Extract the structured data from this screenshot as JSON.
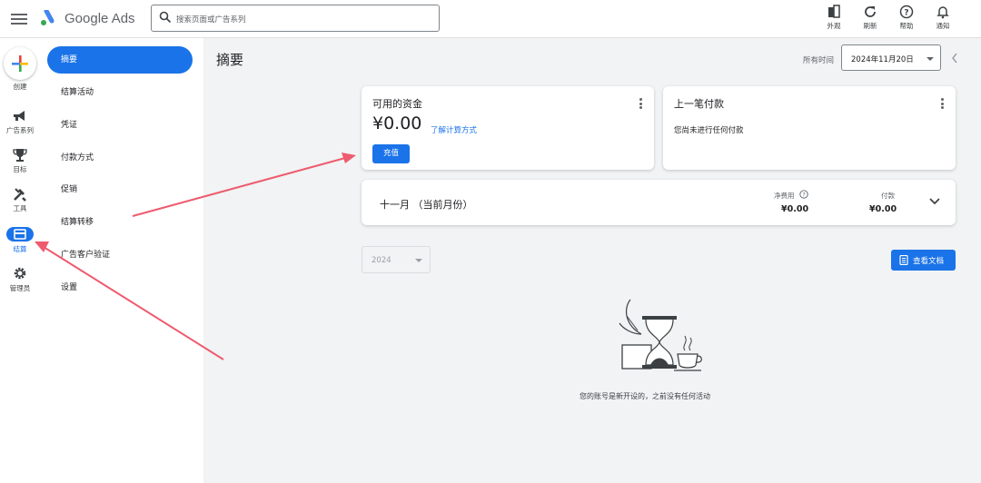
{
  "app": {
    "logo_text": "Google Ads"
  },
  "search": {
    "placeholder": "搜索页面或广告系列"
  },
  "top_actions": [
    {
      "label": "外观",
      "icon": "appearance-icon"
    },
    {
      "label": "刷新",
      "icon": "refresh-icon"
    },
    {
      "label": "帮助",
      "icon": "help-icon"
    },
    {
      "label": "通知",
      "icon": "bell-icon"
    }
  ],
  "rail": {
    "create": "创建",
    "items": [
      {
        "label": "广告系列",
        "icon": "megaphone-icon"
      },
      {
        "label": "目标",
        "icon": "trophy-icon"
      },
      {
        "label": "工具",
        "icon": "tools-icon"
      },
      {
        "label": "结算",
        "icon": "billing-icon"
      },
      {
        "label": "管理员",
        "icon": "gear-icon"
      }
    ]
  },
  "nav": {
    "items": [
      {
        "label": "摘要"
      },
      {
        "label": "结算活动"
      },
      {
        "label": "凭证"
      },
      {
        "label": "付款方式"
      },
      {
        "label": "促销"
      },
      {
        "label": "结算转移"
      },
      {
        "label": "广告客户验证"
      },
      {
        "label": "设置"
      }
    ]
  },
  "main": {
    "title": "摘要",
    "date_label": "所有时间",
    "date_value": "2024年11月20日"
  },
  "funds_card": {
    "title": "可用的资金",
    "amount": "¥0.00",
    "link": "了解计算方式",
    "button": "充值"
  },
  "last_payment_card": {
    "title": "上一笔付款",
    "message": "您尚未进行任何付款"
  },
  "month_card": {
    "title": "十一月 （当前月份）",
    "net_cost_label": "净费用",
    "net_cost_value": "¥0.00",
    "payment_label": "付款",
    "payment_value": "¥0.00"
  },
  "year_select": {
    "value": "2024"
  },
  "docs_button": {
    "label": "查看文档"
  },
  "empty_state": {
    "message": "您的账号是新开设的，之前没有任何活动"
  },
  "colors": {
    "accent": "#1a73e8",
    "annotation_arrow": "#ef5b6e"
  }
}
